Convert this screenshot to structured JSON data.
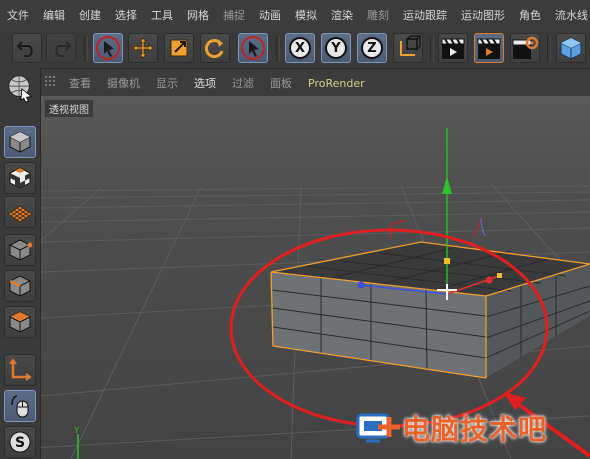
{
  "menu": [
    "文件",
    "编辑",
    "创建",
    "选择",
    "工具",
    "网格",
    "捕捉",
    "动画",
    "模拟",
    "渲染",
    "雕刻",
    "运动跟踪",
    "运动图形",
    "角色",
    "流水线"
  ],
  "toolbar": {
    "undo_icon": "undo-icon",
    "redo_icon": "redo-icon",
    "axis_x": "X",
    "axis_y": "Y",
    "axis_z": "Z"
  },
  "viewport_menu": [
    "查看",
    "摄像机",
    "显示",
    "选项",
    "过滤",
    "面板",
    "ProRender"
  ],
  "viewport_label": "透视视图",
  "watermark": "电脑技术吧",
  "colors": {
    "accent_orange": "#f0a030",
    "selection_blue": "#6d86ac",
    "annotation_red": "#e02020",
    "watermark": "#e8622a"
  }
}
